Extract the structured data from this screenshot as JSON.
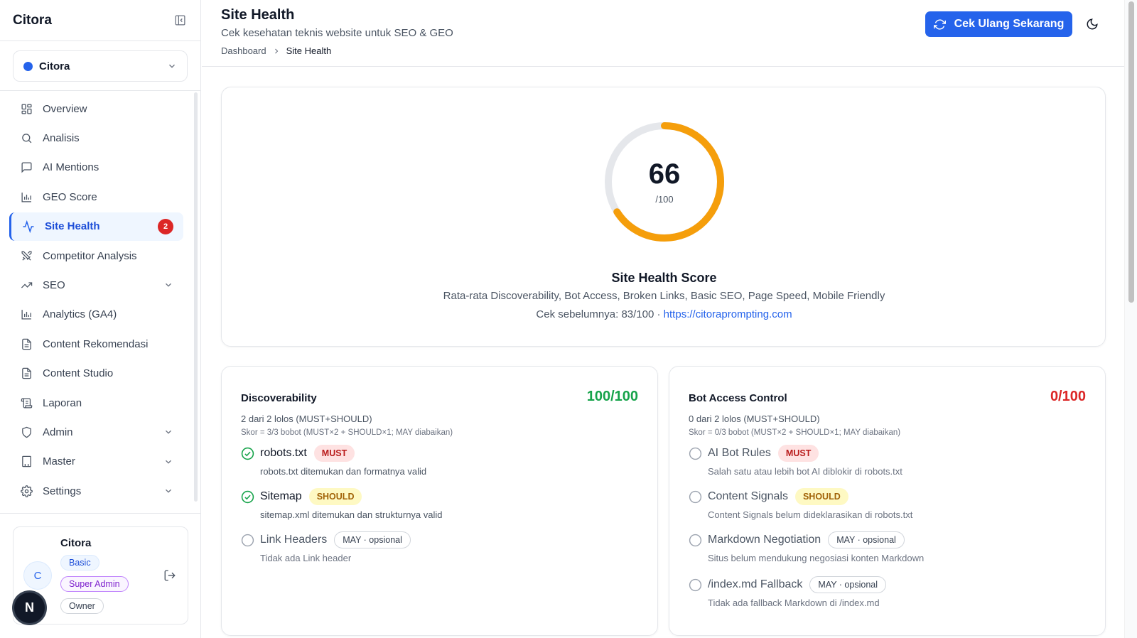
{
  "app": {
    "brand": "Citora"
  },
  "project": {
    "name": "Citora"
  },
  "nav": [
    {
      "label": "Overview",
      "icon": "grid-icon",
      "active": false
    },
    {
      "label": "Analisis",
      "icon": "search-icon",
      "active": false
    },
    {
      "label": "AI Mentions",
      "icon": "message-icon",
      "active": false
    },
    {
      "label": "GEO Score",
      "icon": "bar-chart-icon",
      "active": false
    },
    {
      "label": "Site Health",
      "icon": "activity-icon",
      "active": true,
      "badge": "2"
    },
    {
      "label": "Competitor Analysis",
      "icon": "swords-icon",
      "active": false
    },
    {
      "label": "SEO",
      "icon": "trending-up-icon",
      "active": false,
      "expandable": true
    },
    {
      "label": "Analytics (GA4)",
      "icon": "bar-chart-icon",
      "active": false
    },
    {
      "label": "Content Rekomendasi",
      "icon": "document-icon",
      "active": false
    },
    {
      "label": "Content Studio",
      "icon": "document-icon",
      "active": false
    },
    {
      "label": "Laporan",
      "icon": "scroll-icon",
      "active": false
    },
    {
      "label": "Admin",
      "icon": "shield-icon",
      "active": false,
      "expandable": true
    },
    {
      "label": "Master",
      "icon": "building-icon",
      "active": false,
      "expandable": true
    },
    {
      "label": "Settings",
      "icon": "gear-icon",
      "active": false,
      "expandable": true
    }
  ],
  "user": {
    "name": "Citora",
    "initial": "C",
    "plan": "Basic",
    "role": "Super Admin",
    "membership": "Owner"
  },
  "dev_badge": "N",
  "header": {
    "title": "Site Health",
    "subtitle": "Cek kesehatan teknis website untuk SEO & GEO",
    "breadcrumb": [
      "Dashboard",
      "Site Health"
    ],
    "recheck_label": "Cek Ulang Sekarang"
  },
  "score": {
    "value": 66,
    "max": 100,
    "max_label": "/100",
    "title": "Site Health Score",
    "description": "Rata-rata Discoverability, Bot Access, Broken Links, Basic SEO, Page Speed, Mobile Friendly",
    "previous_prefix": "Cek sebelumnya: 83/100 · ",
    "site_url": "https://citoraprompting.com",
    "color": "#f59e0b"
  },
  "categories": [
    {
      "title": "Discoverability",
      "score": "100/100",
      "score_color": "#16a34a",
      "pass_text": "2 dari 2 lolos (MUST+SHOULD)",
      "weight_text": "Skor = 3/3 bobot (MUST×2 + SHOULD×1; MAY diabaikan)",
      "checks": [
        {
          "name": "robots.txt",
          "tag": "MUST",
          "passed": true,
          "desc": "robots.txt ditemukan dan formatnya valid"
        },
        {
          "name": "Sitemap",
          "tag": "SHOULD",
          "passed": true,
          "desc": "sitemap.xml ditemukan dan strukturnya valid"
        },
        {
          "name": "Link Headers",
          "tag": "MAY · opsional",
          "passed": false,
          "desc": "Tidak ada Link header"
        }
      ]
    },
    {
      "title": "Bot Access Control",
      "score": "0/100",
      "score_color": "#dc2626",
      "pass_text": "0 dari 2 lolos (MUST+SHOULD)",
      "weight_text": "Skor = 0/3 bobot (MUST×2 + SHOULD×1; MAY diabaikan)",
      "checks": [
        {
          "name": "AI Bot Rules",
          "tag": "MUST",
          "passed": false,
          "desc": "Salah satu atau lebih bot AI diblokir di robots.txt"
        },
        {
          "name": "Content Signals",
          "tag": "SHOULD",
          "passed": false,
          "desc": "Content Signals belum dideklarasikan di robots.txt"
        },
        {
          "name": "Markdown Negotiation",
          "tag": "MAY · opsional",
          "passed": false,
          "desc": "Situs belum mendukung negosiasi konten Markdown"
        },
        {
          "name": "/index.md Fallback",
          "tag": "MAY · opsional",
          "passed": false,
          "desc": "Tidak ada fallback Markdown di /index.md"
        }
      ]
    }
  ],
  "colors": {
    "accent": "#2563eb",
    "pass": "#16a34a",
    "fail": "#dc2626",
    "gauge": "#f59e0b",
    "gauge_track": "#e5e7eb"
  }
}
